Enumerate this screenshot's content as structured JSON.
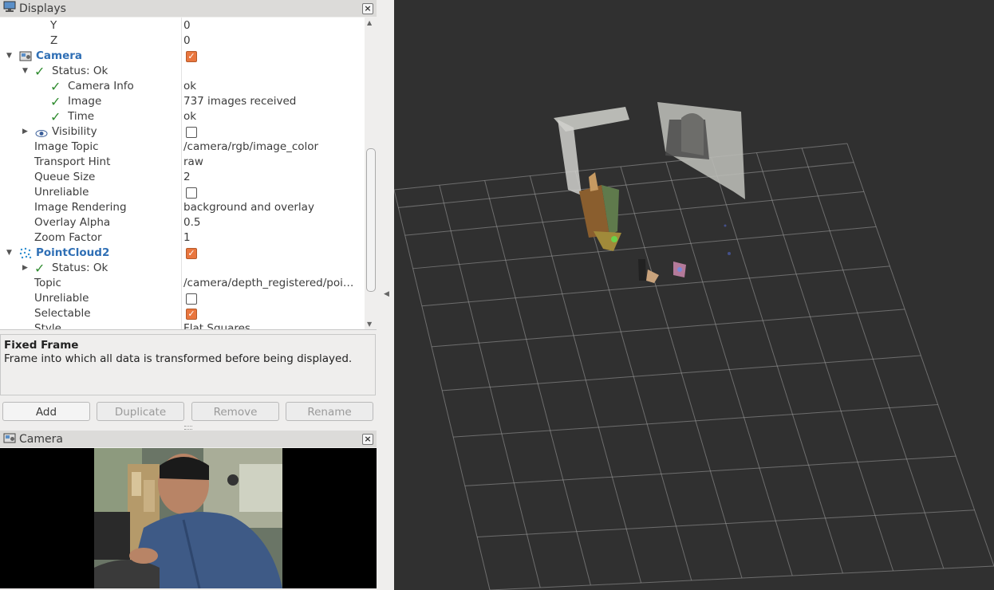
{
  "displays_panel": {
    "title": "Displays",
    "close_glyph": "×"
  },
  "tree": {
    "rows": [
      {
        "name": "Y",
        "value": "0"
      },
      {
        "name": "Z",
        "value": "0"
      },
      {
        "name": "Camera",
        "checked": true
      },
      {
        "name": "Status: Ok"
      },
      {
        "name": "Camera Info",
        "value": "ok"
      },
      {
        "name": "Image",
        "value": "737 images received"
      },
      {
        "name": "Time",
        "value": "ok"
      },
      {
        "name": "Visibility",
        "checked": false
      },
      {
        "name": "Image Topic",
        "value": "/camera/rgb/image_color"
      },
      {
        "name": "Transport Hint",
        "value": "raw"
      },
      {
        "name": "Queue Size",
        "value": "2"
      },
      {
        "name": "Unreliable",
        "checked": false
      },
      {
        "name": "Image Rendering",
        "value": "background and overlay"
      },
      {
        "name": "Overlay Alpha",
        "value": "0.5"
      },
      {
        "name": "Zoom Factor",
        "value": "1"
      },
      {
        "name": "PointCloud2",
        "checked": true
      },
      {
        "name": "Status: Ok"
      },
      {
        "name": "Topic",
        "value": "/camera/depth_registered/poi…"
      },
      {
        "name": "Unreliable",
        "checked": false
      },
      {
        "name": "Selectable",
        "checked": true
      },
      {
        "name": "Style",
        "value": "Flat Squares"
      }
    ]
  },
  "description": {
    "title": "Fixed Frame",
    "text": "Frame into which all data is transformed before being displayed."
  },
  "buttons": {
    "add": "Add",
    "duplicate": "Duplicate",
    "remove": "Remove",
    "rename": "Rename"
  },
  "camera_panel": {
    "title": "Camera",
    "close_glyph": "×"
  },
  "colors": {
    "accent_blue": "#2f6fb5",
    "checkbox_orange": "#e9763e",
    "status_green": "#2e8b2e",
    "view_background": "#303030",
    "grid_line": "#a0a0a0"
  },
  "icons": [
    "monitor-icon",
    "camera-icon",
    "pointcloud-icon",
    "eye-icon",
    "check-icon",
    "close-icon",
    "expand-arrow-icon",
    "collapse-arrow-icon"
  ]
}
